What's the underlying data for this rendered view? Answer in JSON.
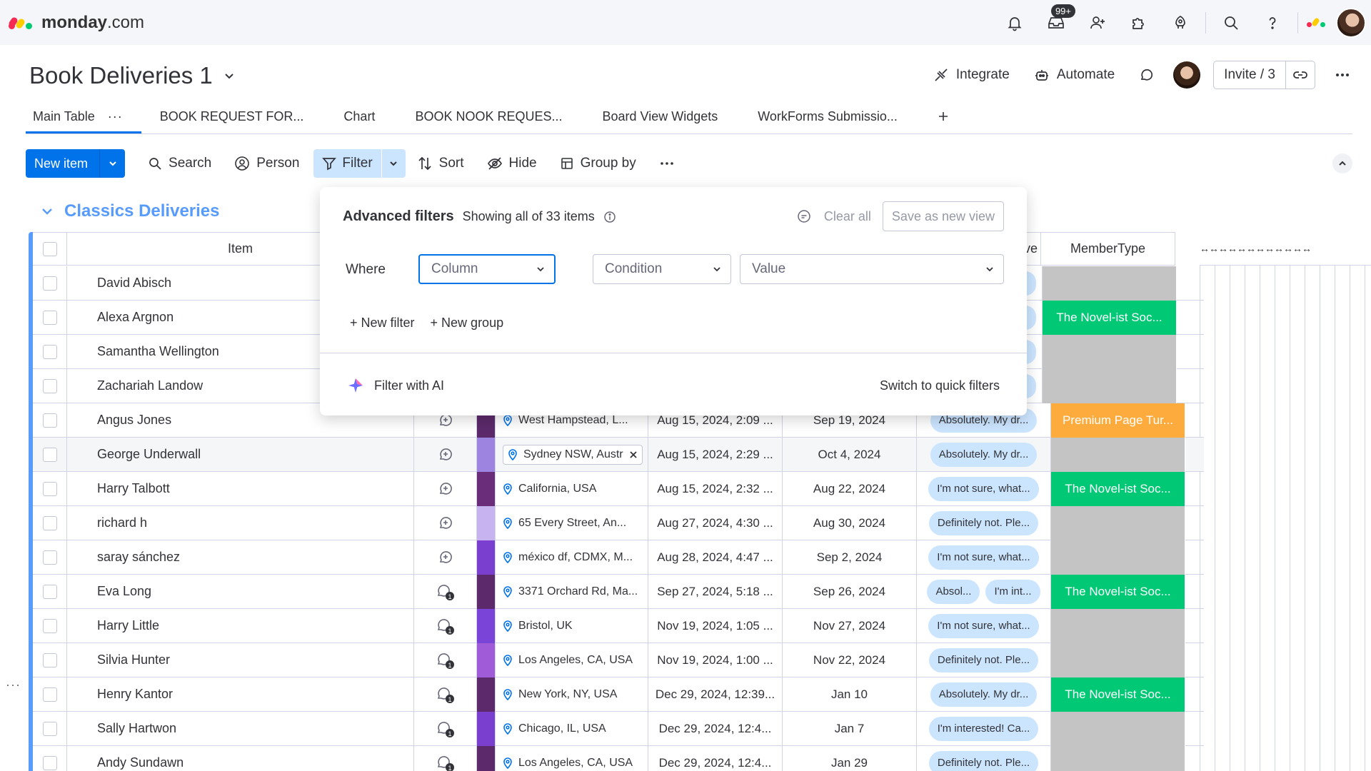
{
  "topnav": {
    "logo_bold": "monday",
    "logo_suffix": ".com",
    "inbox_badge": "99+"
  },
  "board": {
    "title": "Book Deliveries 1",
    "integrate": "Integrate",
    "automate": "Automate",
    "invite": "Invite / 3"
  },
  "tabs": [
    {
      "label": "Main Table",
      "active": true
    },
    {
      "label": "BOOK REQUEST FOR..."
    },
    {
      "label": "Chart"
    },
    {
      "label": "BOOK NOOK REQUES..."
    },
    {
      "label": "Board View Widgets"
    },
    {
      "label": "WorkForms Submissio..."
    }
  ],
  "toolbar": {
    "new_item": "New item",
    "search": "Search",
    "person": "Person",
    "filter": "Filter",
    "sort": "Sort",
    "hide": "Hide",
    "group_by": "Group by"
  },
  "group": {
    "title": "Classics Deliveries"
  },
  "table": {
    "col_item": "Item",
    "col_resp_fragment": "ve",
    "col_member": "MemberType",
    "arrows": "↔↔↔↔↔↔↔↔↔↔↔↔"
  },
  "rows": [
    {
      "name": "David Abisch",
      "member": "",
      "member_color": "gray"
    },
    {
      "name": "Alexa Argnon",
      "member": "The Novel-ist Soc...",
      "member_color": "green"
    },
    {
      "name": "Samantha Wellington",
      "member": "",
      "member_color": "gray"
    },
    {
      "name": "Zachariah Landow",
      "member": "",
      "member_color": "gray"
    },
    {
      "name": "Angus Jones",
      "location": "West Hampstead, L...",
      "created": "Aug 15, 2024, 2:09 ...",
      "date": "Sep 19, 2024",
      "resp": [
        "Absolutely. My dr..."
      ],
      "member": "Premium Page Tur...",
      "member_color": "orange",
      "color": "#5c2a6b"
    },
    {
      "name": "George Underwall",
      "location": "Sydney NSW, Austr",
      "created": "Aug 15, 2024, 2:29 ...",
      "date": "Oct 4, 2024",
      "resp": [
        "Absolutely. My dr..."
      ],
      "member": "",
      "member_color": "gray",
      "color": "#9d84e0"
    },
    {
      "name": "Harry Talbott",
      "location": "California, USA",
      "created": "Aug 15, 2024, 2:32 ...",
      "date": "Aug 22, 2024",
      "resp": [
        "I'm not sure, what..."
      ],
      "member": "The Novel-ist Soc...",
      "member_color": "green",
      "color": "#6a2d7a"
    },
    {
      "name": "richard h",
      "location": "65 Every Street, An...",
      "created": "Aug 27, 2024, 4:30 ...",
      "date": "Aug 30, 2024",
      "resp": [
        "Definitely not. Ple..."
      ],
      "member": "",
      "member_color": "gray",
      "color": "#c6b3ef"
    },
    {
      "name": "saray sánchez",
      "location": "méxico df, CDMX, M...",
      "created": "Aug 28, 2024, 4:47 ...",
      "date": "Sep 2, 2024",
      "resp": [
        "I'm not sure, what..."
      ],
      "member": "",
      "member_color": "gray",
      "color": "#7b3fcf"
    },
    {
      "name": "Eva Long",
      "location": "3371 Orchard Rd, Ma...",
      "created": "Sep 27, 2024, 5:18 ...",
      "date": "Sep 26, 2024",
      "resp": [
        "Absol...",
        "I'm int..."
      ],
      "member": "The Novel-ist Soc...",
      "member_color": "green",
      "color": "#5c2a6b"
    },
    {
      "name": "Harry Little",
      "location": "Bristol, UK",
      "created": "Nov 19, 2024, 1:05 ...",
      "date": "Nov 27, 2024",
      "resp": [
        "I'm not sure, what..."
      ],
      "member": "",
      "member_color": "gray",
      "color": "#7a44d9"
    },
    {
      "name": "Silvia Hunter",
      "location": "Los Angeles, CA, USA",
      "created": "Nov 19, 2024, 1:00 ...",
      "date": "Nov 22, 2024",
      "resp": [
        "Definitely not. Ple..."
      ],
      "member": "",
      "member_color": "gray",
      "color": "#a05cd8"
    },
    {
      "name": "Henry Kantor",
      "location": "New York, NY, USA",
      "created": "Dec 29, 2024, 12:39...",
      "date": "Jan 10",
      "resp": [
        "Absolutely. My dr..."
      ],
      "member": "The Novel-ist Soc...",
      "member_color": "green",
      "color": "#5c2a6b"
    },
    {
      "name": "Sally Hartwon",
      "location": "Chicago, IL, USA",
      "created": "Dec 29, 2024, 12:4...",
      "date": "Jan 7",
      "resp": [
        "I'm interested! Ca..."
      ],
      "member": "",
      "member_color": "gray",
      "color": "#7b3fcf"
    },
    {
      "name": "Andy Sundawn",
      "location": "Los Angeles, CA, USA",
      "created": "Dec 29, 2024, 12:4...",
      "date": "Jan 29",
      "resp": [
        "Definitely not. Ple..."
      ],
      "member": "",
      "member_color": "gray",
      "color": "#5c2a6b"
    }
  ],
  "filter_panel": {
    "title": "Advanced filters",
    "subtitle": "Showing all of 33 items",
    "clear_all": "Clear all",
    "save_view": "Save as new view",
    "where": "Where",
    "column_placeholder": "Column",
    "condition_placeholder": "Condition",
    "value_placeholder": "Value",
    "new_filter": "+ New filter",
    "new_group": "+ New group",
    "filter_ai": "Filter with AI",
    "quick_filters": "Switch to quick filters"
  },
  "colors": {
    "accent": "#0073ea",
    "group": "#579bfc",
    "green": "#00c875",
    "orange": "#fdab3d",
    "gray": "#c4c4c4",
    "pill": "#cce5ff"
  }
}
